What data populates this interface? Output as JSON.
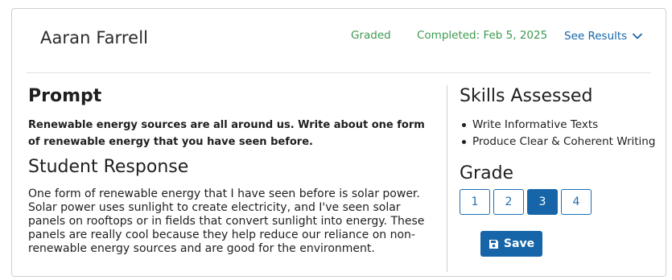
{
  "header": {
    "student_name": "Aaran Farrell",
    "graded_label": "Graded",
    "completed_label": "Completed: Feb 5, 2025",
    "see_results_label": "See Results",
    "status_color": "#3d9a4f",
    "link_color": "#1565a8"
  },
  "prompt": {
    "title": "Prompt",
    "text": "Renewable energy sources are all around us. Write about one form of renewable energy that you have seen before."
  },
  "response": {
    "title": "Student Response",
    "text": "One form of renewable energy that I have seen before is solar power. Solar power uses sunlight to create electricity, and I've seen solar panels on rooftops or in fields that convert sunlight into energy. These panels are really cool because they help reduce our reliance on non-renewable energy sources and are good for the environment."
  },
  "skills": {
    "title": "Skills Assessed",
    "items": [
      {
        "label": "Write Informative Texts"
      },
      {
        "label": "Produce Clear & Coherent Writing"
      }
    ]
  },
  "grade": {
    "title": "Grade",
    "options": [
      "1",
      "2",
      "3",
      "4"
    ],
    "selected": "3",
    "accent_color": "#1565a8"
  },
  "save": {
    "label": "Save",
    "icon": "save-icon"
  }
}
